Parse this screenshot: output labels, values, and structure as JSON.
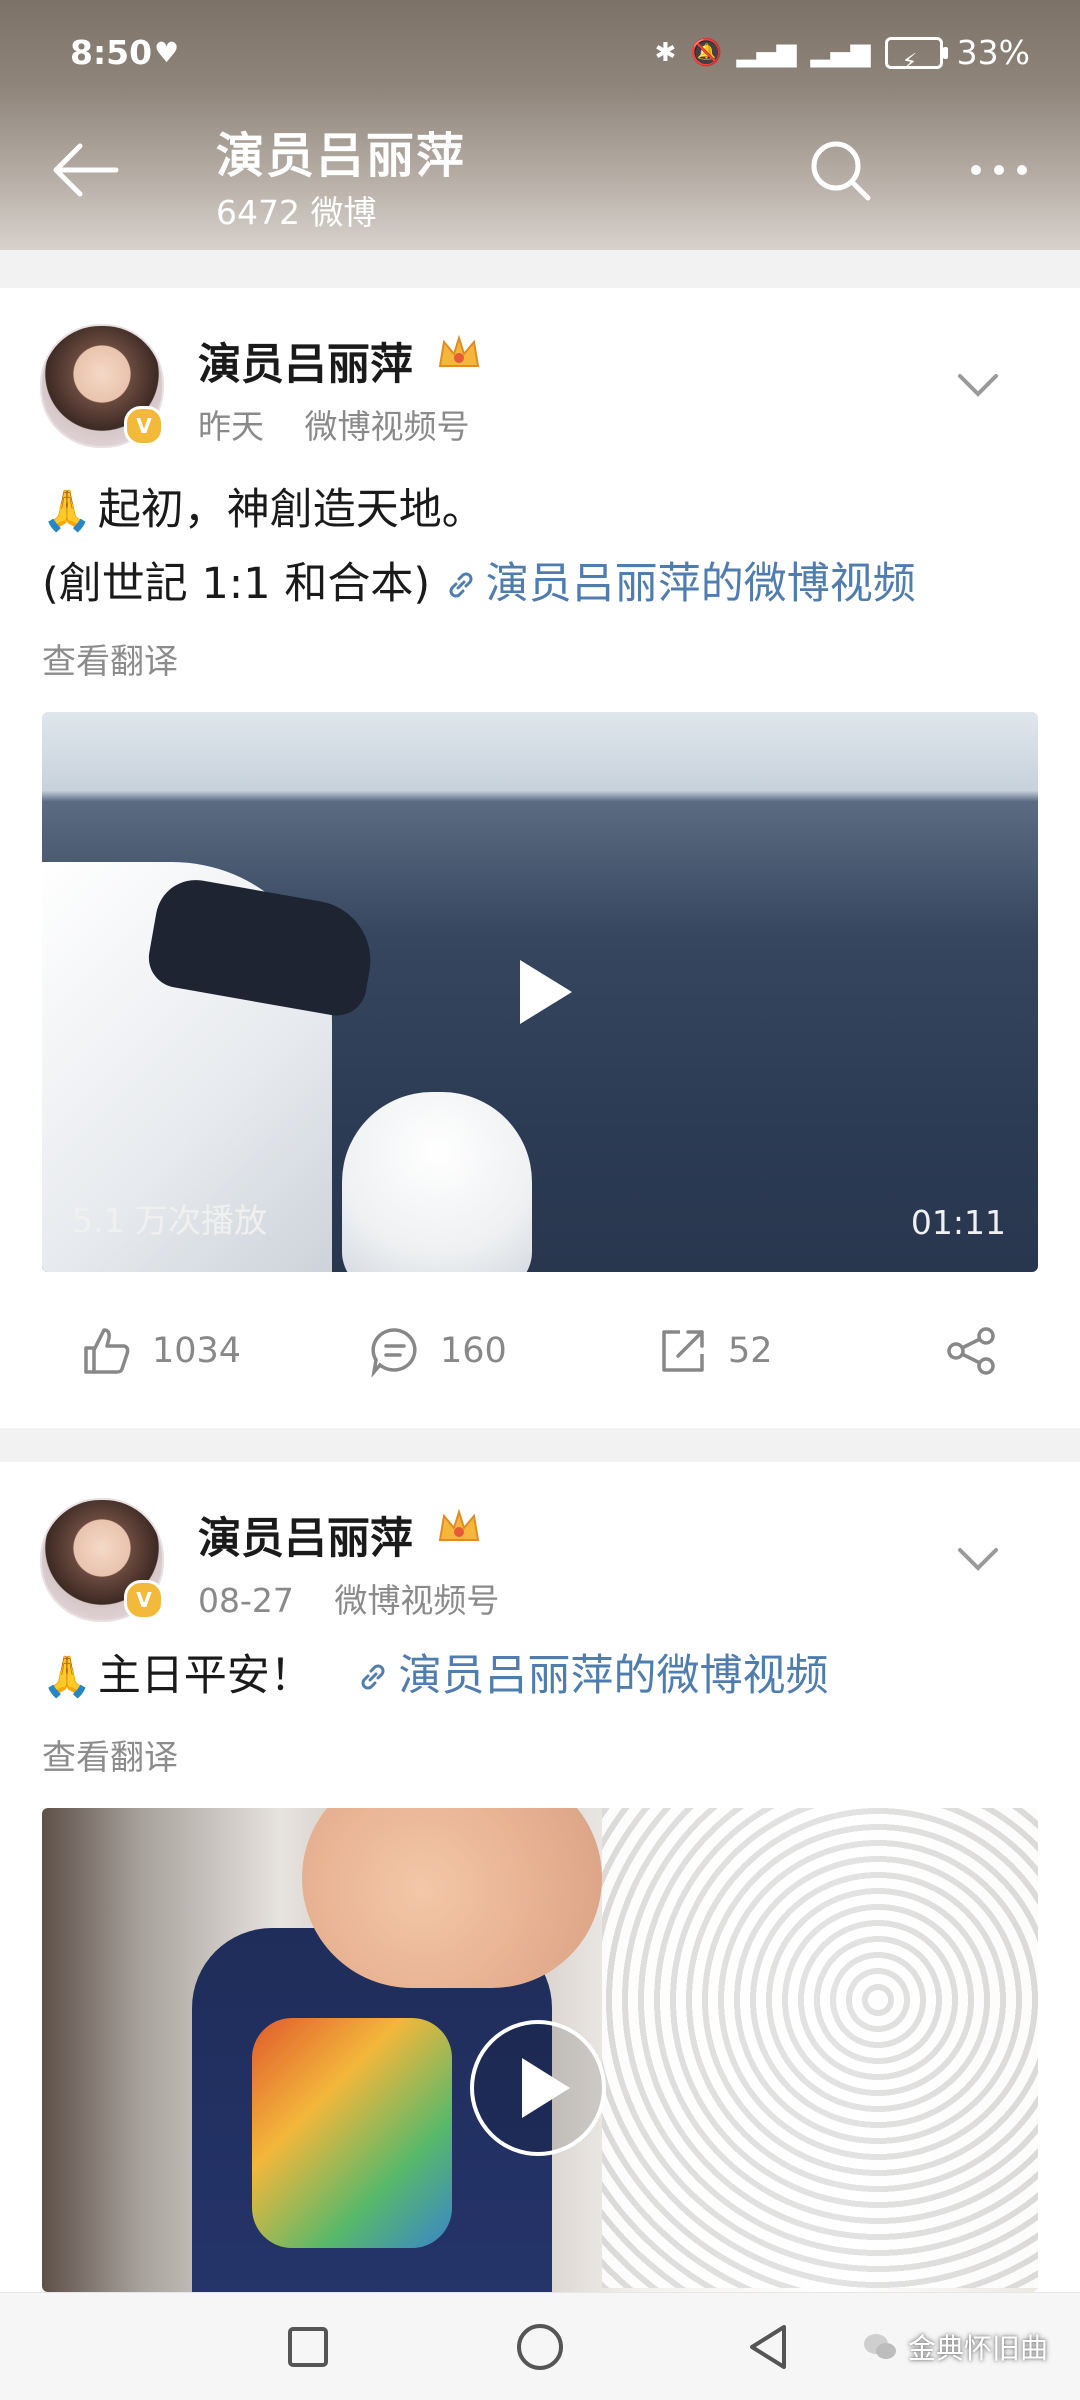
{
  "status_bar": {
    "time": "8:50",
    "battery": "33%"
  },
  "header": {
    "title": "演员吕丽萍",
    "subtitle": "6472 微博"
  },
  "posts": [
    {
      "author": "演员吕丽萍",
      "time": "昨天",
      "source": "微博视频号",
      "text_line1": "起初，神創造天地。",
      "text_line2_prefix": "(創世記 1:1 和合本)",
      "link_text": "演员吕丽萍的微博视频",
      "translate": "查看翻译",
      "video": {
        "views": "5.1 万次播放",
        "duration": "01:11"
      },
      "actions": {
        "likes": "1034",
        "comments": "160",
        "reposts": "52"
      }
    },
    {
      "author": "演员吕丽萍",
      "time": "08-27",
      "source": "微博视频号",
      "text_line1": "主日平安！",
      "link_text": "演员吕丽萍的微博视频",
      "translate": "查看翻译"
    }
  ],
  "watermark": {
    "text": "金典怀旧曲"
  },
  "colors": {
    "link": "#507daf",
    "meta": "#8a8a8a",
    "accent_gold": "#f2b93b"
  },
  "icons": {
    "back": "back-arrow-icon",
    "search": "search-icon",
    "more": "more-icon",
    "crown": "crown-icon",
    "chevron": "chevron-down-icon",
    "link": "link-icon",
    "play": "play-icon",
    "like": "like-icon",
    "comment": "comment-icon",
    "repost": "repost-icon",
    "share": "share-icon"
  }
}
